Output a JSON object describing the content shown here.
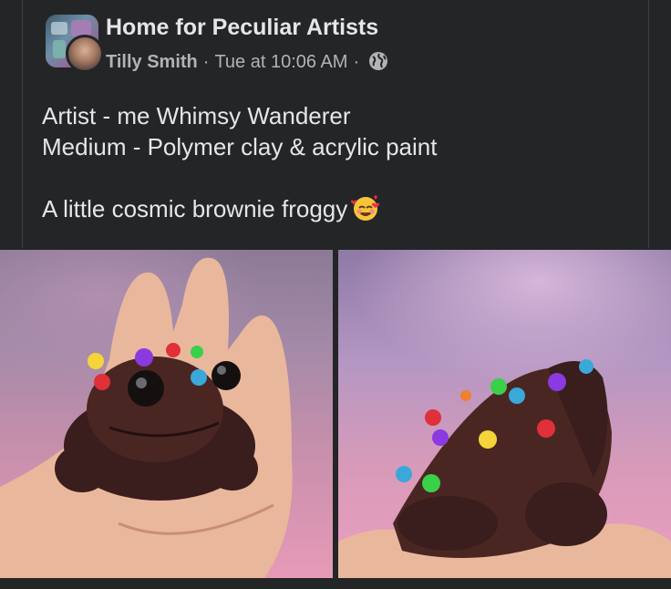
{
  "post": {
    "group_name": "Home for Peculiar Artists",
    "author": "Tilly Smith",
    "separator": "·",
    "timestamp": "Tue at 10:06 AM",
    "audience_icon": "globe-icon",
    "text_lines": [
      "Artist - me Whimsy Wanderer",
      "Medium - Polymer clay & acrylic paint"
    ],
    "caption": "A little cosmic brownie froggy",
    "caption_emoji": "smiling-face-with-hearts-icon"
  },
  "photos": [
    {
      "subject": "clay frog figurine on hand",
      "alt": ""
    },
    {
      "subject": "clay frog figurine back view",
      "alt": ""
    }
  ],
  "colors": {
    "background": "#242526",
    "primary_text": "#e4e6eb",
    "secondary_text": "#b0b3b8"
  }
}
